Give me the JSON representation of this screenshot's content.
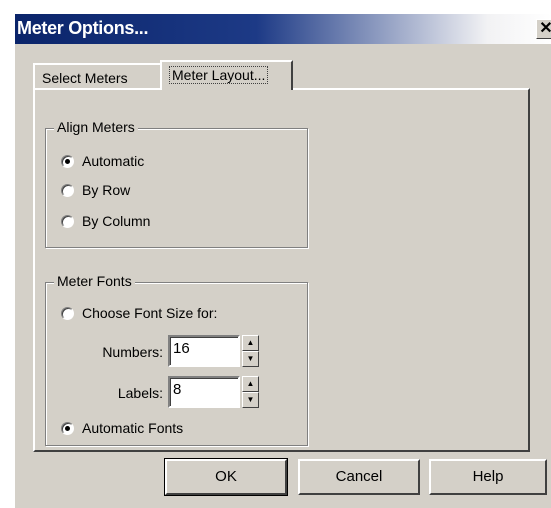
{
  "dialog": {
    "title": "Meter Options...",
    "close_glyph": "✕"
  },
  "tabs": [
    {
      "label": "Select Meters",
      "active": false
    },
    {
      "label": "Meter Layout...",
      "active": true
    }
  ],
  "align_meters": {
    "legend": "Align Meters",
    "options": [
      {
        "label": "Automatic",
        "selected": true
      },
      {
        "label": "By Row",
        "selected": false
      },
      {
        "label": "By Column",
        "selected": false
      }
    ]
  },
  "meter_fonts": {
    "legend": "Meter Fonts",
    "choose_font_size": {
      "label": "Choose Font Size for:",
      "selected": false
    },
    "numbers": {
      "label": "Numbers:",
      "value": "16"
    },
    "labels": {
      "label": "Labels:",
      "value": "8"
    },
    "automatic_fonts": {
      "label": "Automatic Fonts",
      "selected": true
    }
  },
  "buttons": {
    "ok": "OK",
    "cancel": "Cancel",
    "help": "Help"
  }
}
